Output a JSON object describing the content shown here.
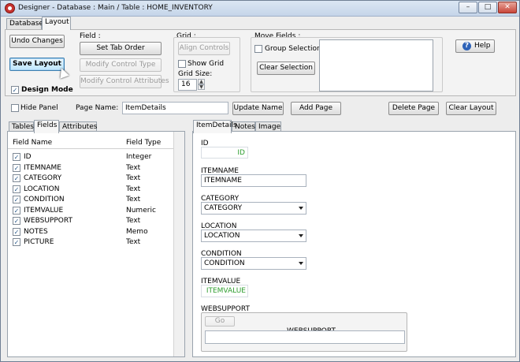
{
  "window": {
    "title": "Designer - Database : Main / Table : HOME_INVENTORY",
    "controls": [
      "–",
      "□",
      "✕"
    ]
  },
  "top_tabs": [
    "Database",
    "Layout"
  ],
  "toolbar": {
    "undo_label": "Undo Changes",
    "save_label": "Save Layout",
    "design_mode_label": "Design Mode",
    "field_group": "Field :",
    "set_tab_order": "Set Tab Order",
    "modify_control_type": "Modify Control Type",
    "modify_control_attributes": "Modify Control Attributes",
    "grid_group": "Grid :",
    "align_controls": "Align Controls",
    "show_grid": "Show Grid",
    "grid_size_label": "Grid Size:",
    "grid_size_value": "16",
    "move_fields_group": "Move Fields :",
    "group_selection": "Group Selection",
    "clear_selection": "Clear Selection",
    "help": "Help"
  },
  "page_bar": {
    "hide_panel": "Hide Panel",
    "page_name_label": "Page Name:",
    "page_name_value": "ItemDetails",
    "update_name": "Update Name",
    "add_page": "Add Page",
    "delete_page": "Delete Page",
    "clear_layout": "Clear Layout"
  },
  "left_tabs": [
    "Tables",
    "Fields",
    "Attributes"
  ],
  "fields_table": {
    "headers": [
      "Field Name",
      "Field Type"
    ],
    "rows": [
      {
        "name": "ID",
        "type": "Integer"
      },
      {
        "name": "ITEMNAME",
        "type": "Text"
      },
      {
        "name": "CATEGORY",
        "type": "Text"
      },
      {
        "name": "LOCATION",
        "type": "Text"
      },
      {
        "name": "CONDITION",
        "type": "Text"
      },
      {
        "name": "ITEMVALUE",
        "type": "Numeric"
      },
      {
        "name": "WEBSUPPORT",
        "type": "Text"
      },
      {
        "name": "NOTES",
        "type": "Memo"
      },
      {
        "name": "PICTURE",
        "type": "Text"
      }
    ]
  },
  "right_tabs": [
    "ItemDetails",
    "Notes",
    "Image"
  ],
  "form": {
    "id_label": "ID",
    "id_value": "ID",
    "itemname_label": "ITEMNAME",
    "itemname_value": "ITEMNAME",
    "category_label": "CATEGORY",
    "category_value": "CATEGORY",
    "location_label": "LOCATION",
    "location_value": "LOCATION",
    "condition_label": "CONDITION",
    "condition_value": "CONDITION",
    "itemvalue_label": "ITEMVALUE",
    "itemvalue_value": "ITEMVALUE",
    "websupport_label": "WEBSUPPORT",
    "go_label": "Go",
    "websupport_value": "WEBSUPPORT"
  },
  "icons": {
    "app": "app-logo-icon",
    "help": "help-question-icon",
    "check": "checkbox-check-icon",
    "combo": "dropdown-arrow-icon"
  },
  "colors": {
    "accent_green": "#2e9d2e",
    "title_bar": "#c5d5e9"
  }
}
